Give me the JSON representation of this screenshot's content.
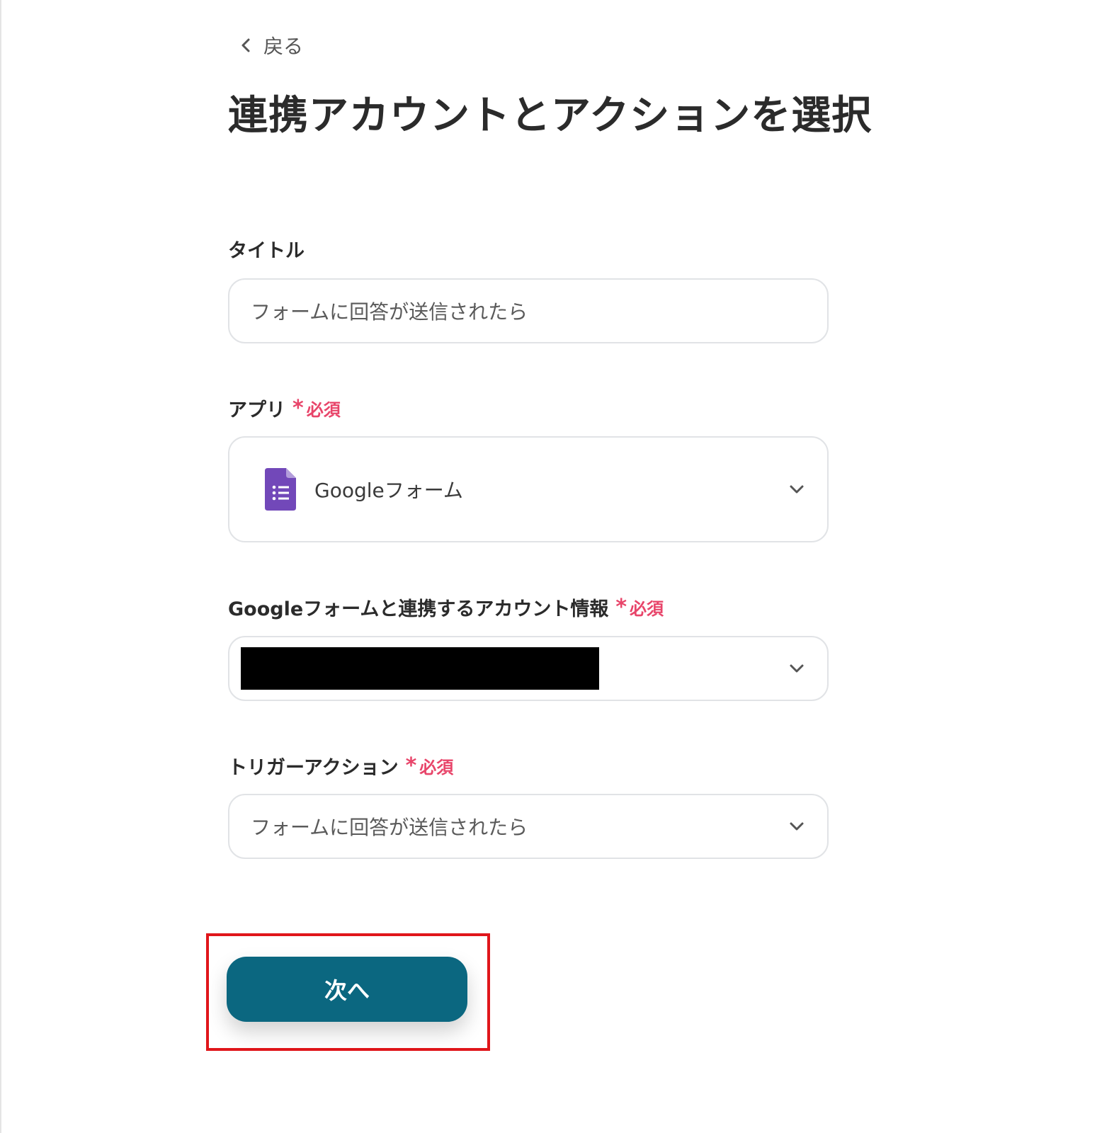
{
  "back": {
    "label": "戻る",
    "icon": "chevron-left-icon"
  },
  "page": {
    "title": "連携アカウントとアクションを選択"
  },
  "fields": {
    "title": {
      "label": "タイトル",
      "value": "フォームに回答が送信されたら"
    },
    "app": {
      "label": "アプリ",
      "required": "必須",
      "value": "Googleフォーム",
      "icon": "google-forms-icon"
    },
    "account": {
      "label": "Googleフォームと連携するアカウント情報",
      "required": "必須",
      "value_redacted": true
    },
    "trigger": {
      "label": "トリガーアクション",
      "required": "必須",
      "value": "フォームに回答が送信されたら"
    }
  },
  "next": {
    "label": "次へ"
  },
  "colors": {
    "accent": "#0b6780",
    "required": "#e8456a",
    "highlight": "#e0161b",
    "forms_purple": "#7248b9"
  }
}
